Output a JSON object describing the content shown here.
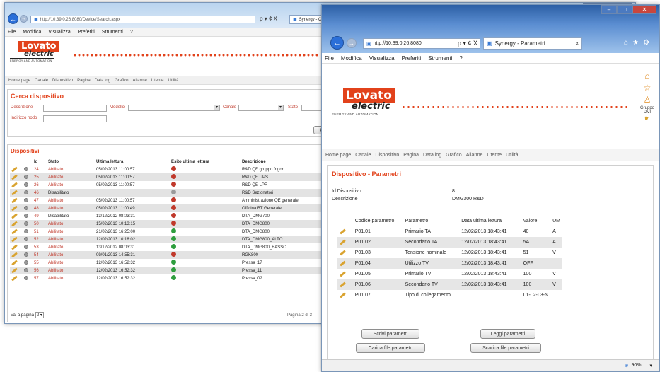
{
  "win1": {
    "address": "http://10.39.0.26:8080/Device/Search.aspx",
    "address_icons": "ρ ▾ ¢ X",
    "tab_label": "Synergy - Cerca dispositivo",
    "menu": [
      "File",
      "Modifica",
      "Visualizza",
      "Preferiti",
      "Strumenti",
      "?"
    ],
    "nav": [
      "Home page",
      "Canale",
      "Dispositivo",
      "Pagina",
      "Data log",
      "Grafico",
      "Allarme",
      "Utente",
      "Utilità"
    ],
    "search": {
      "title": "Cerca dispositivo",
      "label_descrizione": "Descrizione",
      "label_modello": "Modello",
      "label_canale": "Canale",
      "label_stato": "Stato",
      "label_indirizzo": "Indirizzo nodo",
      "button_partial": "C"
    },
    "devices": {
      "title": "Dispositivi",
      "headers": [
        "Id",
        "Stato",
        "Ultima lettura",
        "Esito ultima lettura",
        "Descrizione"
      ],
      "rows": [
        {
          "id": "24",
          "stato": "Abilitato",
          "lettura": "05/02/2013 11:00:57",
          "esito": "#c0392b",
          "desc": "R&D QE gruppo frigor"
        },
        {
          "id": "25",
          "stato": "Abilitato",
          "lettura": "05/02/2013 11:00:57",
          "esito": "#c0392b",
          "desc": "R&D QE UPS"
        },
        {
          "id": "26",
          "stato": "Abilitato",
          "lettura": "05/02/2013 11:00:57",
          "esito": "#c0392b",
          "desc": "R&D QE LPR"
        },
        {
          "id": "46",
          "stato": "Disabilitato",
          "lettura": "",
          "esito": "#9a9a9a",
          "desc": "R&D Sezionatori"
        },
        {
          "id": "47",
          "stato": "Abilitato",
          "lettura": "05/02/2013 11:00:57",
          "esito": "#c0392b",
          "desc": "Amministrazione QE generale"
        },
        {
          "id": "48",
          "stato": "Abilitato",
          "lettura": "05/02/2013 11:00:49",
          "esito": "#c0392b",
          "desc": "Officina BT Generale"
        },
        {
          "id": "49",
          "stato": "Disabilitato",
          "lettura": "13/12/2012 08:03:31",
          "esito": "#c0392b",
          "desc": "DTA_DMG700"
        },
        {
          "id": "50",
          "stato": "Abilitato",
          "lettura": "15/02/2013 10:13:15",
          "esito": "#c0392b",
          "desc": "DTA_DMG800"
        },
        {
          "id": "51",
          "stato": "Abilitato",
          "lettura": "21/02/2013 16:25:00",
          "esito": "#2e9e3e",
          "desc": "DTA_DMG800"
        },
        {
          "id": "52",
          "stato": "Abilitato",
          "lettura": "12/02/2013 10:18:02",
          "esito": "#2e9e3e",
          "desc": "DTA_DMG800_ALTO"
        },
        {
          "id": "53",
          "stato": "Abilitato",
          "lettura": "13/12/2012 08:03:31",
          "esito": "#2e9e3e",
          "desc": "DTA_DMG800_BASSO"
        },
        {
          "id": "54",
          "stato": "Abilitato",
          "lettura": "09/01/2013 14:55:31",
          "esito": "#c0392b",
          "desc": "RGK800"
        },
        {
          "id": "55",
          "stato": "Abilitato",
          "lettura": "12/02/2013 16:52:32",
          "esito": "#2e9e3e",
          "desc": "Pressa_17"
        },
        {
          "id": "56",
          "stato": "Abilitato",
          "lettura": "12/02/2013 16:52:32",
          "esito": "#2e9e3e",
          "desc": "Pressa_11"
        },
        {
          "id": "57",
          "stato": "Abilitato",
          "lettura": "12/02/2013 16:52:32",
          "esito": "#2e9e3e",
          "desc": "Pressa_02"
        }
      ],
      "goto_label": "Vai a pagina",
      "goto_value": "2",
      "page_info": "Pagina 2 di 3"
    }
  },
  "win2": {
    "address": "http://10.39.0.26:8080",
    "address_icons": "ρ ▾ ¢ X",
    "tab_label": "Synergy - Parametri",
    "menu": [
      "File",
      "Modifica",
      "Visualizza",
      "Preferiti",
      "Strumenti",
      "?"
    ],
    "nav": [
      "Home page",
      "Canale",
      "Dispositivo",
      "Pagina",
      "Data log",
      "Grafico",
      "Allarme",
      "Utente",
      "Utilità"
    ],
    "side": {
      "group_label": "Gruppo",
      "group_value": "DVI"
    },
    "page_title": "Dispositivo - Parametri",
    "device_id_label": "Id Dispositivo",
    "device_id_value": "8",
    "device_desc_label": "Descrizione",
    "device_desc_value": "DMG300 R&D",
    "param_headers": [
      "Codice parametro",
      "Parametro",
      "Data ultima lettura",
      "Valore",
      "UM"
    ],
    "params": [
      {
        "code": "P01.01",
        "name": "Primario TA",
        "date": "12/02/2013 18:43:41",
        "value": "40",
        "um": "A"
      },
      {
        "code": "P01.02",
        "name": "Secondario TA",
        "date": "12/02/2013 18:43:41",
        "value": "5A",
        "um": "A"
      },
      {
        "code": "P01.03",
        "name": "Tensione nominale",
        "date": "12/02/2013 18:43:41",
        "value": "51",
        "um": "V"
      },
      {
        "code": "P01.04",
        "name": "Utilizzo TV",
        "date": "12/02/2013 18:43:41",
        "value": "OFF",
        "um": ""
      },
      {
        "code": "P01.05",
        "name": "Primario TV",
        "date": "12/02/2013 18:43:41",
        "value": "100",
        "um": "V"
      },
      {
        "code": "P01.06",
        "name": "Secondario TV",
        "date": "12/02/2013 18:43:41",
        "value": "100",
        "um": "V"
      },
      {
        "code": "P01.07",
        "name": "Tipo di collegamento",
        "date": "",
        "value": "L1-L2-L3-N",
        "um": ""
      }
    ],
    "buttons": {
      "write": "Scrivi parametri",
      "read": "Leggi parametri",
      "load": "Carica file parametri",
      "download": "Scarica file parametri"
    },
    "zoom": "90%"
  },
  "logo": {
    "top": "Lovato",
    "bottom": "electric",
    "sub": "ENERGY AND AUTOMATION"
  },
  "colors": {
    "brand": "#e2421b",
    "ok": "#2e9e3e",
    "error": "#c0392b",
    "disabled": "#9a9a9a"
  }
}
